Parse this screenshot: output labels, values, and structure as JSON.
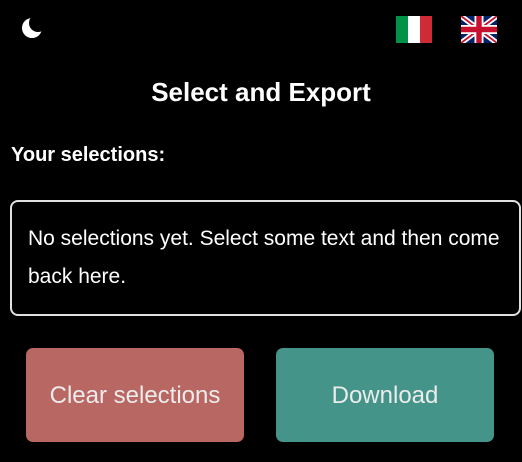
{
  "header": {
    "theme_toggle_icon": "moon-icon",
    "languages": [
      {
        "code": "it",
        "icon": "italian-flag-icon"
      },
      {
        "code": "en",
        "icon": "uk-flag-icon"
      }
    ]
  },
  "main": {
    "title": "Select and Export",
    "selections_heading": "Your selections:",
    "empty_message": "No selections yet. Select some text and then come back here."
  },
  "actions": {
    "clear_label": "Clear selections",
    "download_label": "Download"
  },
  "colors": {
    "background": "#000000",
    "text": "#ffffff",
    "clear_button": "#b96763",
    "download_button": "#44948a",
    "box_border": "#e0e0e0"
  }
}
